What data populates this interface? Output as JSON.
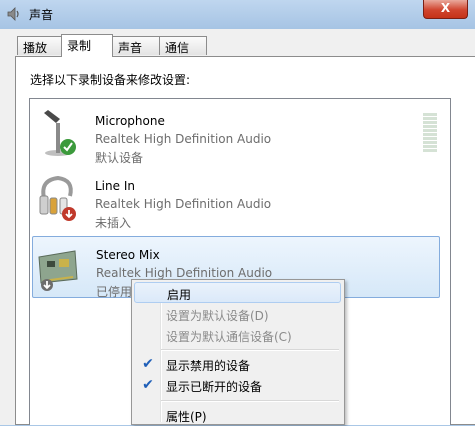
{
  "window": {
    "title": "声音",
    "close_label": "X"
  },
  "tabs": [
    {
      "label": "播放"
    },
    {
      "label": "录制"
    },
    {
      "label": "声音"
    },
    {
      "label": "通信"
    }
  ],
  "recording": {
    "instruction": "选择以下录制设备来修改设置:",
    "devices": [
      {
        "name": "Microphone",
        "driver": "Realtek High Definition Audio",
        "status": "默认设备"
      },
      {
        "name": "Line In",
        "driver": "Realtek High Definition Audio",
        "status": "未插入"
      },
      {
        "name": "Stereo Mix",
        "driver": "Realtek High Definition Audio",
        "status": "已停用"
      }
    ]
  },
  "context_menu": {
    "items": [
      {
        "label": "启用"
      },
      {
        "label": "设置为默认设备(D)"
      },
      {
        "label": "设置为默认通信设备(C)"
      },
      {
        "label": "显示禁用的设备"
      },
      {
        "label": "显示已断开的设备"
      },
      {
        "label": "属性(P)"
      }
    ]
  },
  "colors": {
    "accent": "#3c9a3c",
    "selection": "#d6e8f8",
    "window_frame": "#a9c7e6"
  },
  "icons": {
    "default": "green-check-icon",
    "unplugged": "red-down-arrow-icon",
    "disabled": "gray-down-arrow-icon"
  }
}
